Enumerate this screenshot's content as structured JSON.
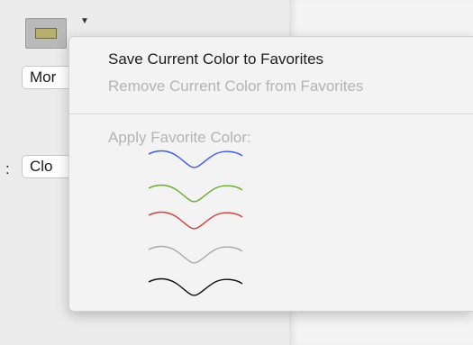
{
  "panel": {
    "buttons": [
      {
        "label": "Mor"
      },
      {
        "label": "Clo"
      }
    ],
    "colon": ":",
    "swatch_color": "#b8af6e"
  },
  "menu": {
    "save_label": "Save Current Color to Favorites",
    "remove_label": "Remove Current Color from Favorites",
    "apply_header": "Apply Favorite Color:",
    "favorites": [
      {
        "color": "#3a5cf5"
      },
      {
        "color": "#6aae2e"
      },
      {
        "color": "#d2403a"
      },
      {
        "color": "#aaaaaa"
      },
      {
        "color": "#111111"
      }
    ]
  }
}
